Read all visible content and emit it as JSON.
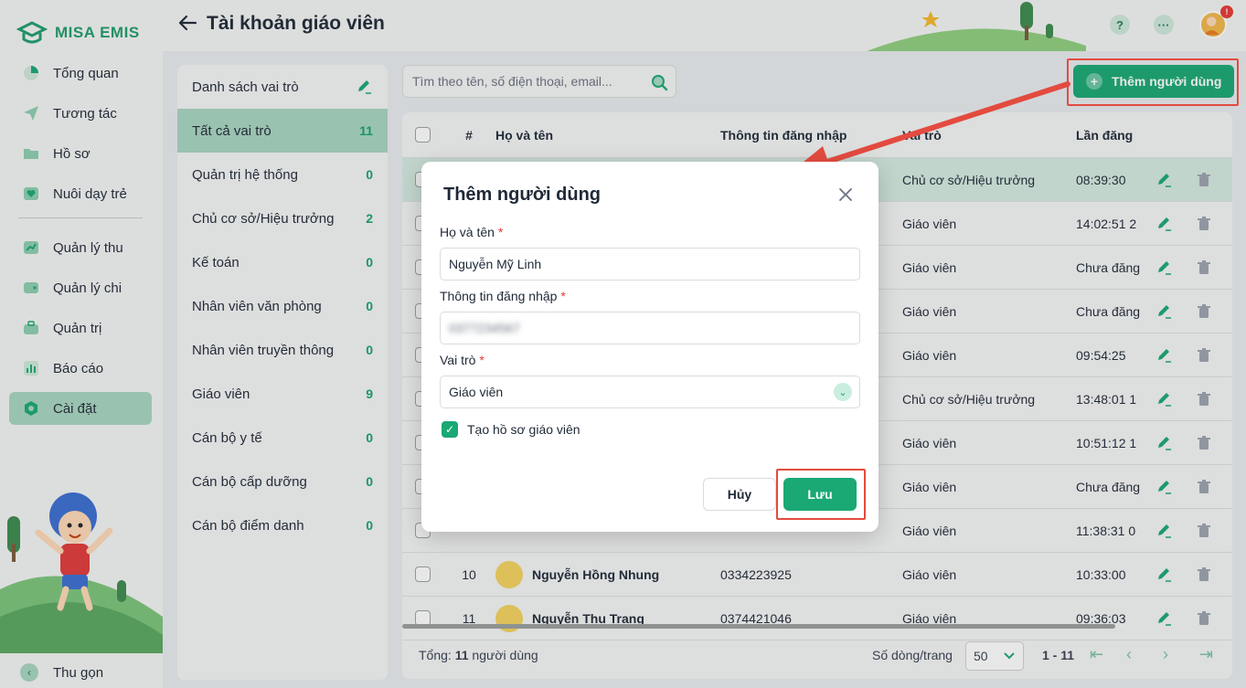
{
  "app": {
    "brand": "MISA EMIS",
    "page_title": "Tài khoản giáo viên",
    "notification_badge": "!"
  },
  "sidebar": {
    "items": [
      {
        "label": "Tổng quan",
        "icon": "pie-chart-icon"
      },
      {
        "label": "Tương tác",
        "icon": "paper-plane-icon"
      },
      {
        "label": "Hồ sơ",
        "icon": "folder-icon"
      },
      {
        "label": "Nuôi dạy trẻ",
        "icon": "heart-icon"
      },
      {
        "label": "Quản lý thu",
        "icon": "income-chart-icon"
      },
      {
        "label": "Quản lý chi",
        "icon": "wallet-icon"
      },
      {
        "label": "Quản trị",
        "icon": "briefcase-icon"
      },
      {
        "label": "Báo cáo",
        "icon": "bar-chart-icon"
      },
      {
        "label": "Cài đặt",
        "icon": "settings-icon",
        "active": true
      }
    ],
    "collapse_label": "Thu gọn"
  },
  "roles": {
    "header": "Danh sách vai trò",
    "items": [
      {
        "label": "Tất cả vai trò",
        "count": "11",
        "active": true
      },
      {
        "label": "Quản trị hệ thống",
        "count": "0"
      },
      {
        "label": "Chủ cơ sở/Hiệu trưởng",
        "count": "2"
      },
      {
        "label": "Kế toán",
        "count": "0"
      },
      {
        "label": "Nhân viên văn phòng",
        "count": "0"
      },
      {
        "label": "Nhân viên truyền thông",
        "count": "0"
      },
      {
        "label": "Giáo viên",
        "count": "9"
      },
      {
        "label": "Cán bộ y tế",
        "count": "0"
      },
      {
        "label": "Cán bộ cấp dưỡng",
        "count": "0"
      },
      {
        "label": "Cán bộ điểm danh",
        "count": "0"
      }
    ]
  },
  "search": {
    "placeholder": "Tìm theo tên, số điện thoại, email..."
  },
  "toolbar": {
    "add_user_label": "Thêm người dùng"
  },
  "table": {
    "columns": [
      "#",
      "Họ và tên",
      "Thông tin đăng nhập",
      "Vai trò",
      "Lần đăng"
    ],
    "rows": [
      {
        "num": "",
        "name": "",
        "login": "",
        "role": "Chủ cơ sở/Hiệu trưởng",
        "time": "08:39:30"
      },
      {
        "num": "",
        "name": "",
        "login": "",
        "role": "Giáo viên",
        "time": "14:02:51 2"
      },
      {
        "num": "",
        "name": "",
        "login": "",
        "role": "Giáo viên",
        "time": "Chưa đăng"
      },
      {
        "num": "",
        "name": "",
        "login": "",
        "role": "Giáo viên",
        "time": "Chưa đăng"
      },
      {
        "num": "",
        "name": "",
        "login": "",
        "role": "Giáo viên",
        "time": "09:54:25"
      },
      {
        "num": "",
        "name": "",
        "login": "",
        "role": "Chủ cơ sở/Hiệu trưởng",
        "time": "13:48:01 1"
      },
      {
        "num": "",
        "name": "",
        "login": "",
        "role": "Giáo viên",
        "time": "10:51:12 1"
      },
      {
        "num": "",
        "name": "",
        "login": "",
        "role": "Giáo viên",
        "time": "Chưa đăng"
      },
      {
        "num": "",
        "name": "",
        "login": "",
        "role": "Giáo viên",
        "time": "11:38:31 0"
      },
      {
        "num": "10",
        "name": "Nguyễn Hồng Nhung",
        "login": "0334223925",
        "role": "Giáo viên",
        "time": "10:33:00"
      },
      {
        "num": "11",
        "name": "Nguyễn Thu Trang",
        "login": "0374421046",
        "role": "Giáo viên",
        "time": "09:36:03"
      }
    ],
    "footer": {
      "total_prefix": "Tổng:",
      "total_count": "11",
      "total_suffix": "người dùng",
      "rows_per_page_label": "Số dòng/trang",
      "rows_per_page": "50",
      "range": "1 - 11"
    }
  },
  "modal": {
    "title": "Thêm người dùng",
    "name_label": "Họ và tên",
    "name_value": "Nguyễn Mỹ Linh",
    "login_label": "Thông tin đăng nhập",
    "login_value": "0377234567",
    "role_label": "Vai trò",
    "role_value": "Giáo viên",
    "checkbox_label": "Tạo hồ sơ giáo viên",
    "cancel_label": "Hủy",
    "save_label": "Lưu",
    "required_mark": "*"
  },
  "colors": {
    "accent": "#1aa874",
    "active_bg": "#a8d5c1",
    "highlight": "#e34b3f"
  }
}
